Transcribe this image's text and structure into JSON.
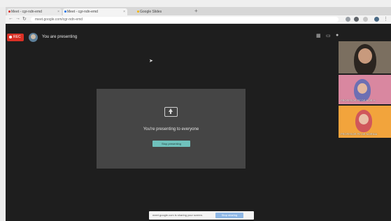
{
  "browser": {
    "tabs": [
      {
        "label": "Meet - cgr-ndn-emd",
        "dot_color": "#d93025"
      },
      {
        "label": "Meet - cgr-ndn-emd",
        "dot_color": "#1a73e8"
      },
      {
        "label": "Google Slides",
        "dot_color": "#f4b400"
      }
    ],
    "url": "meet.google.com/cgr-ndn-emd",
    "icons": {
      "back": "back-arrow-icon",
      "forward": "forward-arrow-icon",
      "reload": "reload-icon"
    }
  },
  "meeting": {
    "rec_label": "REC",
    "presenting_label": "You are presenting",
    "card": {
      "message": "You're presenting to everyone",
      "stop_button": "Stop presenting"
    },
    "participants": [
      {
        "name": ""
      },
      {
        "name": "PROFESOR PE DE NOR H"
      },
      {
        "name": "PROFESOR PE DE NORNIA"
      }
    ],
    "share_bar": {
      "text": "meet.google.com is sharing your screen.",
      "button": "Stop sharing"
    },
    "colors": {
      "rec": "#d93025",
      "stop_button": "#6fc1bc",
      "share_button": "#8fb8e6"
    }
  }
}
